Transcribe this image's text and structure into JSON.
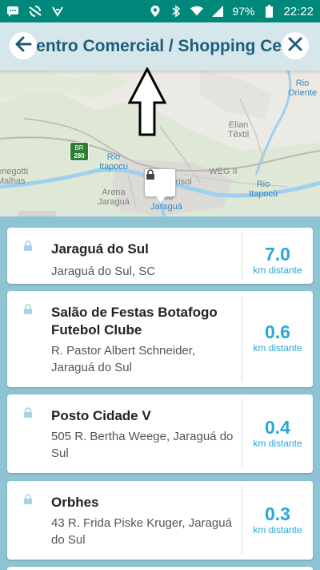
{
  "status_bar": {
    "battery": "97%",
    "time": "22:22",
    "left_icons": [
      "message-icon",
      "sync-icon",
      "checklist-icon"
    ],
    "right_icons": [
      "location-icon",
      "bluetooth-icon",
      "wifi-icon",
      "signal-icon",
      "battery-icon"
    ]
  },
  "header": {
    "title": "Centro Comercial / Shopping Ce..."
  },
  "map": {
    "road_shield": {
      "top": "BR",
      "bottom": "280"
    },
    "labels": {
      "rio_oriente": "Rio Oriente",
      "elian_textil": "Elian Têxtil",
      "rio_itapocu_1": "Rio Itapocu",
      "weg_ii": "WEG II",
      "rio_itapocu_2": "Rio Itapocú",
      "arena_jaragua": "Arena Jaraguá",
      "marisol": "Marisol",
      "rio_jaragua": "Rio Jaraguá",
      "negotti_malhas": "enegotti Malhas"
    }
  },
  "results": [
    {
      "name": "Jaraguá do Sul",
      "address": "Jaraguá do Sul, SC",
      "distance": "7.0",
      "unit": "km distante"
    },
    {
      "name": "Salão de Festas Botafogo Futebol Clube",
      "address": "R. Pastor Albert Schneider, Jaraguá do Sul",
      "distance": "0.6",
      "unit": "km distante"
    },
    {
      "name": "Posto Cidade V",
      "address": "505 R. Bertha Weege, Jaraguá do Sul",
      "distance": "0.4",
      "unit": "km distante"
    },
    {
      "name": "Orbhes",
      "address": "43 R. Frida Piske Kruger, Jaraguá do Sul",
      "distance": "0.3",
      "unit": "km distante"
    }
  ],
  "colors": {
    "status_bar": "#00897b",
    "accent": "#29a8d8",
    "title": "#1f5c7a",
    "list_bg": "#8ec3d4"
  }
}
